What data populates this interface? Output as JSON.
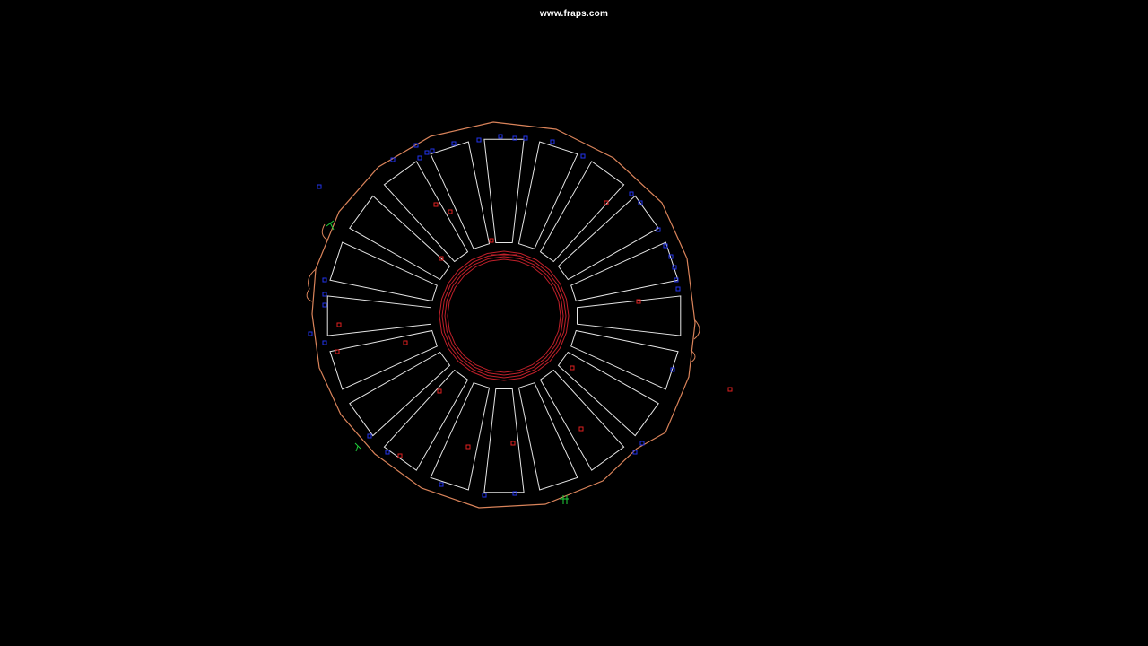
{
  "watermark": {
    "text": "www.fraps.com"
  },
  "drawing": {
    "background_color": "#000000",
    "outline_color": "#d9835a",
    "segment_color": "#e6e6e6",
    "hub_color": "#c0202a",
    "marker_blue_color": "#2233ee",
    "marker_red_color": "#e02020",
    "marker_green_color": "#1fcf3a",
    "segment_count": 20,
    "view": "cad-top-view"
  }
}
